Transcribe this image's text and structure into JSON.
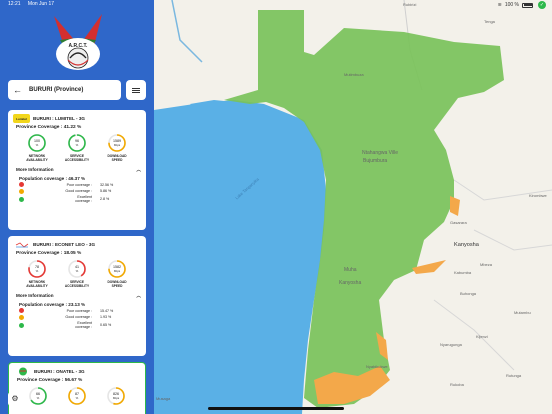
{
  "status": {
    "time": "12:21",
    "date": "Mon Jun 17",
    "battery": "100 %"
  },
  "logo": {
    "text": "A.R.C.T."
  },
  "search": {
    "label": "BURURI (Province)"
  },
  "cards": [
    {
      "id": "lumitel",
      "logo_text": "Lumitel",
      "color": "#f2d61b",
      "title": "BURURI : LUMITEL - 3G",
      "coverage": "Province Coverage : 41.22 %",
      "gauges": [
        {
          "value": "100",
          "unit": "%",
          "label1": "NETWORK",
          "label2": "AVAILABILITY",
          "level": 1.0,
          "color": "#2db84a"
        },
        {
          "value": "96",
          "unit": "%",
          "label1": "SERVICE",
          "label2": "ACCESSIBILITY",
          "level": 0.96,
          "color": "#2db84a"
        },
        {
          "value": "1589",
          "unit": "Kbps",
          "label1": "DOWNLOAD",
          "label2": "SPEED",
          "level": 0.75,
          "color": "#f2a900"
        }
      ],
      "more": "More Information",
      "population": "Population coverage : 46.37 %",
      "legend": [
        {
          "label": "Poor coverage :",
          "value": "32.56 %",
          "color": "#e53935"
        },
        {
          "label": "Good coverage :",
          "value": "5.86 %",
          "color": "#f2a900"
        },
        {
          "label": "Excellent coverage :",
          "value": "2.8 %",
          "color": "#2db84a"
        }
      ]
    },
    {
      "id": "econet",
      "logo_text": "",
      "color": "#ffffff",
      "title": "BURURI : ECONET LEO - 3G",
      "coverage": "Province Coverage : 18.05 %",
      "gauges": [
        {
          "value": "78",
          "unit": "%",
          "label1": "NETWORK",
          "label2": "AVAILABILITY",
          "level": 0.78,
          "color": "#e53935"
        },
        {
          "value": "41",
          "unit": "%",
          "label1": "SERVICE",
          "label2": "ACCESSIBILITY",
          "level": 0.41,
          "color": "#e53935"
        },
        {
          "value": "1582",
          "unit": "Kbps",
          "label1": "DOWNLOAD",
          "label2": "SPEED",
          "level": 0.75,
          "color": "#f2a900"
        }
      ],
      "more": "More Information",
      "population": "Population coverage : 23.13 %",
      "legend": [
        {
          "label": "Poor coverage :",
          "value": "15.47 %",
          "color": "#e53935"
        },
        {
          "label": "Good coverage :",
          "value": "1.93 %",
          "color": "#f2a900"
        },
        {
          "label": "Excellent coverage :",
          "value": "0.65 %",
          "color": "#2db84a"
        }
      ]
    },
    {
      "id": "onatel",
      "logo_text": "",
      "color": "#2db84a",
      "title": "BURURI : ONATEL - 3G",
      "coverage": "Province Coverage : 56.67 %",
      "gauges": [
        {
          "value": "66",
          "unit": "%",
          "label1": "",
          "label2": "",
          "level": 0.66,
          "color": "#2db84a"
        },
        {
          "value": "87",
          "unit": "%",
          "label1": "",
          "label2": "",
          "level": 0.87,
          "color": "#f2a900"
        },
        {
          "value": "826",
          "unit": "Kbps",
          "label1": "",
          "label2": "",
          "level": 0.55,
          "color": "#f2a900"
        }
      ]
    }
  ],
  "map": {
    "labels": [
      "Rubirizi",
      "Tenga",
      "Mutimbuza",
      "Ntahangwa Ville",
      "Bujumbura",
      "Lake Tanganyika",
      "Gasarara",
      "Kirombwe",
      "Kanyosha",
      "Mbeza",
      "Kabumba",
      "Buhonga",
      "Muha",
      "Kanyosha",
      "Mutambu",
      "Nyarugunga",
      "Kijenzi",
      "Nyabikokwe",
      "Rukoba",
      "Rutunga",
      "Musaga"
    ],
    "water_color": "#5ab0e6",
    "coverage_green": "#7ac25a",
    "coverage_orange": "#f3a84a"
  },
  "settings_icon": "gear-icon"
}
